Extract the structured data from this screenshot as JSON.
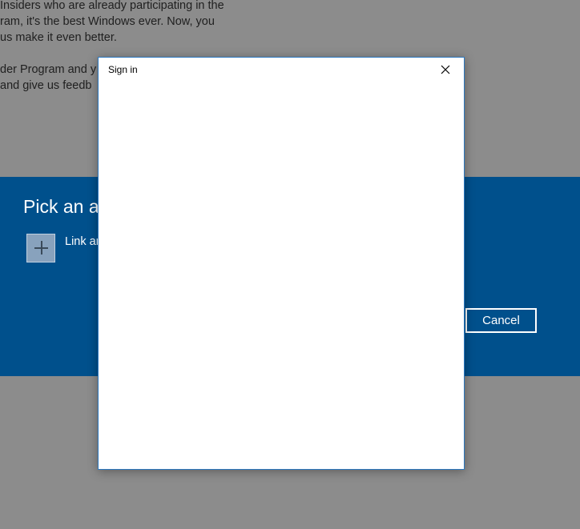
{
  "background": {
    "lines": [
      "Insiders who are already participating in the",
      "ram, it's the best Windows ever. Now, you",
      "us make it even better.",
      "",
      "der Program and y",
      " and give us feedb"
    ]
  },
  "account_panel": {
    "title": "Pick an ac",
    "link_label": "Link ar",
    "add_icon": "plus-icon",
    "cancel_label": "Cancel",
    "band_color": "#00508c"
  },
  "signin_dialog": {
    "title": "Sign in",
    "close_icon": "close-icon",
    "border_color": "#2b78c0"
  }
}
